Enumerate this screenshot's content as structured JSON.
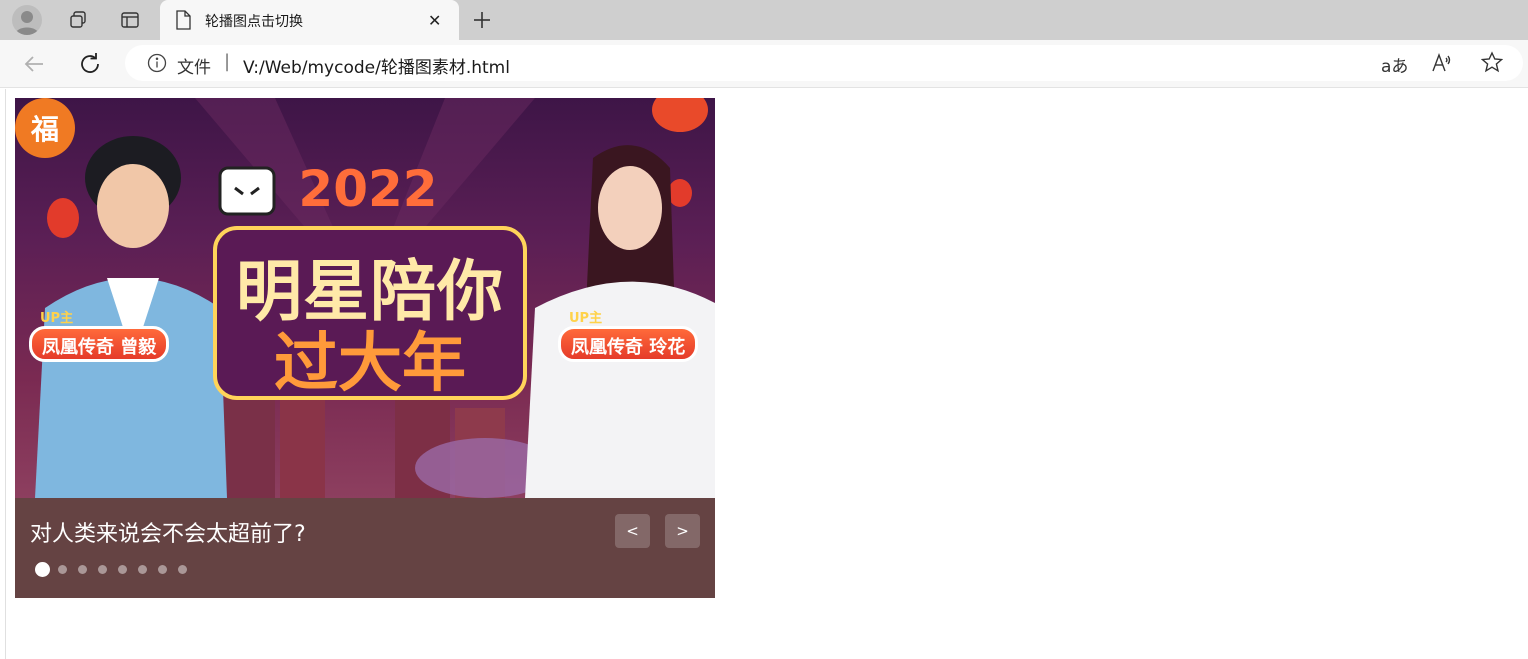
{
  "browser": {
    "tab_title": "轮播图点击切换",
    "address": {
      "file_label": "文件",
      "separator": "|",
      "url": "V:/Web/mycode/轮播图素材.html"
    },
    "icons": [
      "profile-icon",
      "workspaces-icon",
      "tab-actions-icon",
      "document-icon",
      "close-icon",
      "new-tab-icon",
      "back-icon",
      "reload-icon",
      "info-icon",
      "translate-icon",
      "read-aloud-icon",
      "favorite-icon"
    ],
    "omnibox_icon_text": {
      "translate": "aあ",
      "read_aloud": "A",
      "favorite": "☆"
    }
  },
  "carousel": {
    "banner": {
      "year": "2022",
      "headline_1": "明星陪你",
      "headline_2": "过大年",
      "left_tag": {
        "up": "UP主",
        "text": "凤凰传奇 曾毅"
      },
      "right_tag": {
        "up": "UP主",
        "text": "凤凰传奇 玲花"
      },
      "fu": "福"
    },
    "caption": "对人类来说会不会太超前了?",
    "prev_label": "<",
    "next_label": ">",
    "dot_count": 8,
    "active_dot": 0,
    "colors": {
      "panel": "#654343",
      "dot_active": "#ffffff"
    }
  }
}
